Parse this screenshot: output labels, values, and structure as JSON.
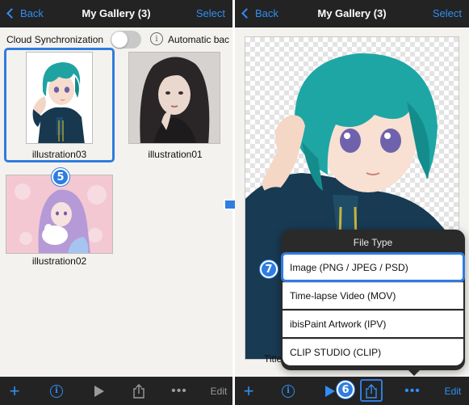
{
  "left": {
    "nav": {
      "back": "Back",
      "title": "My Gallery (3)",
      "select": "Select"
    },
    "sync": {
      "label": "Cloud Synchronization",
      "auto_backup": "Automatic bac",
      "toggle_on": false
    },
    "artworks": [
      {
        "caption": "illustration03"
      },
      {
        "caption": "illustration01"
      },
      {
        "caption": "illustration02"
      }
    ],
    "step_badge": "5",
    "toolbar": {
      "edit": "Edit"
    }
  },
  "right": {
    "nav": {
      "back": "Back",
      "title": "My Gallery (3)",
      "select": "Select"
    },
    "title_peek": "Title",
    "popover": {
      "title": "File Type",
      "options": [
        "Image (PNG / JPEG / PSD)",
        "Time-lapse Video (MOV)",
        "ibisPaint Artwork (IPV)",
        "CLIP STUDIO (CLIP)"
      ],
      "highlighted_index": 0
    },
    "step_badge_popover": "7",
    "step_badge_share": "6",
    "toolbar": {
      "edit": "Edit"
    }
  },
  "colors": {
    "accent": "#2f8ff5",
    "highlight": "#2f7ddf",
    "bar": "#232323",
    "background": "#f4f2ee"
  },
  "icons": [
    "plus-icon",
    "info-icon",
    "play-icon",
    "share-icon",
    "more-icon",
    "arrow-right-icon",
    "chevron-left-icon"
  ]
}
